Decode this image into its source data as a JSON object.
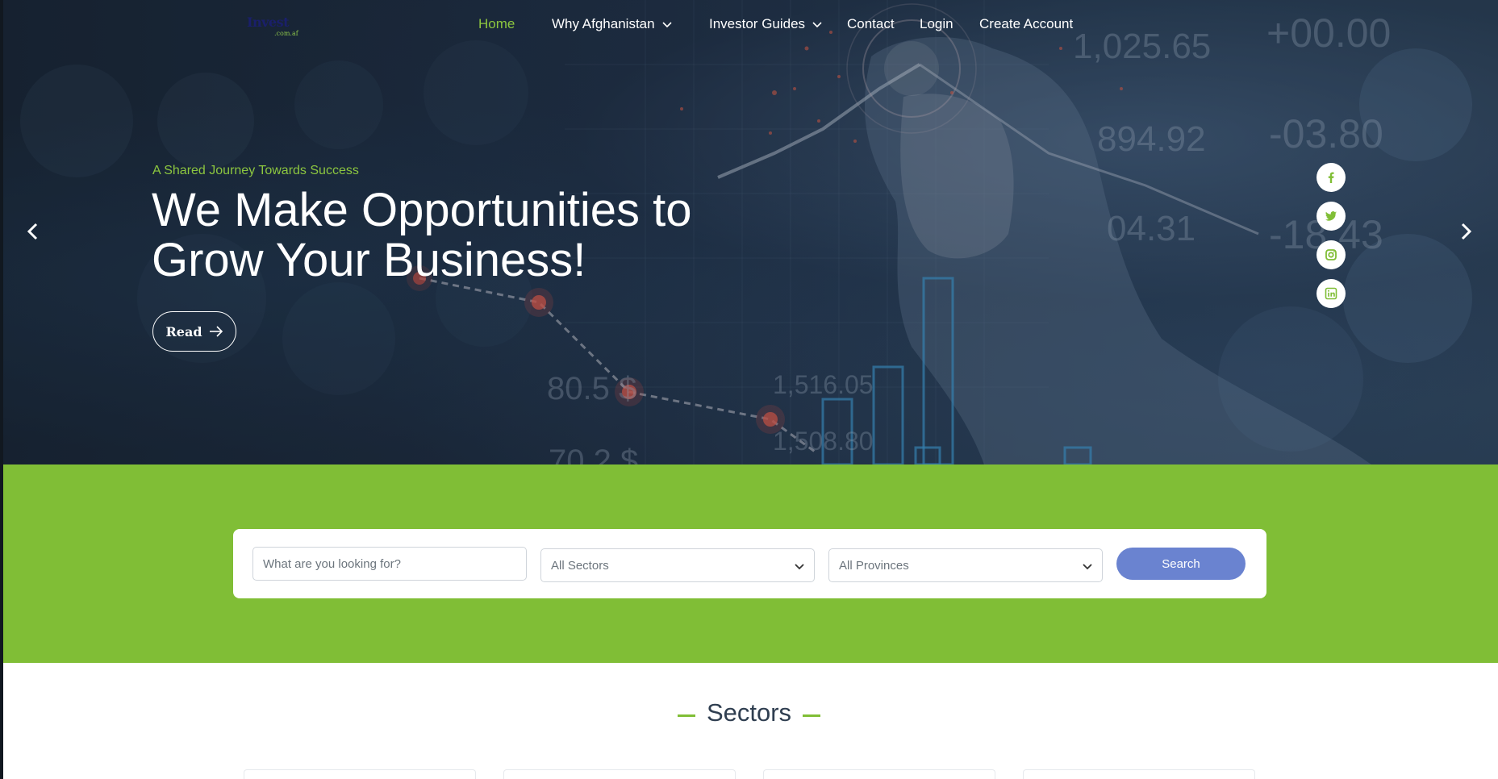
{
  "nav": {
    "logo": {
      "main": "Invest",
      "sub": ".com.af"
    },
    "items": [
      {
        "label": "Home",
        "active": true,
        "dropdown": false
      },
      {
        "label": "Why Afghanistan",
        "active": false,
        "dropdown": true
      },
      {
        "label": "Investor Guides",
        "active": false,
        "dropdown": true
      },
      {
        "label": "Contact",
        "active": false,
        "dropdown": false
      },
      {
        "label": "Login",
        "active": false,
        "dropdown": false
      },
      {
        "label": "Create Account",
        "active": false,
        "dropdown": false
      }
    ]
  },
  "hero": {
    "tagline": "A Shared Journey Towards Success",
    "headline_line1": "We Make Opportunities to",
    "headline_line2": "Grow Your Business!",
    "read_label": "Read",
    "background_numbers": [
      "1,025.65",
      "+00.00",
      "894.92",
      "-03.80",
      "04.31",
      "-18.43",
      "1,516.05",
      "1,508.80",
      "80.5 $",
      "70.2 $"
    ],
    "social": [
      {
        "icon": "facebook-icon"
      },
      {
        "icon": "twitter-icon"
      },
      {
        "icon": "instagram-icon"
      },
      {
        "icon": "linkedin-icon"
      }
    ]
  },
  "search": {
    "placeholder": "What are you looking for?",
    "sector_select": "All Sectors",
    "province_select": "All Provinces",
    "button_label": "Search"
  },
  "sectors": {
    "title": "Sectors"
  },
  "colors": {
    "accent_green": "#80be36",
    "nav_active": "#8cc63f",
    "search_button": "#6a83d0",
    "heading_dark": "#2f3e50"
  }
}
